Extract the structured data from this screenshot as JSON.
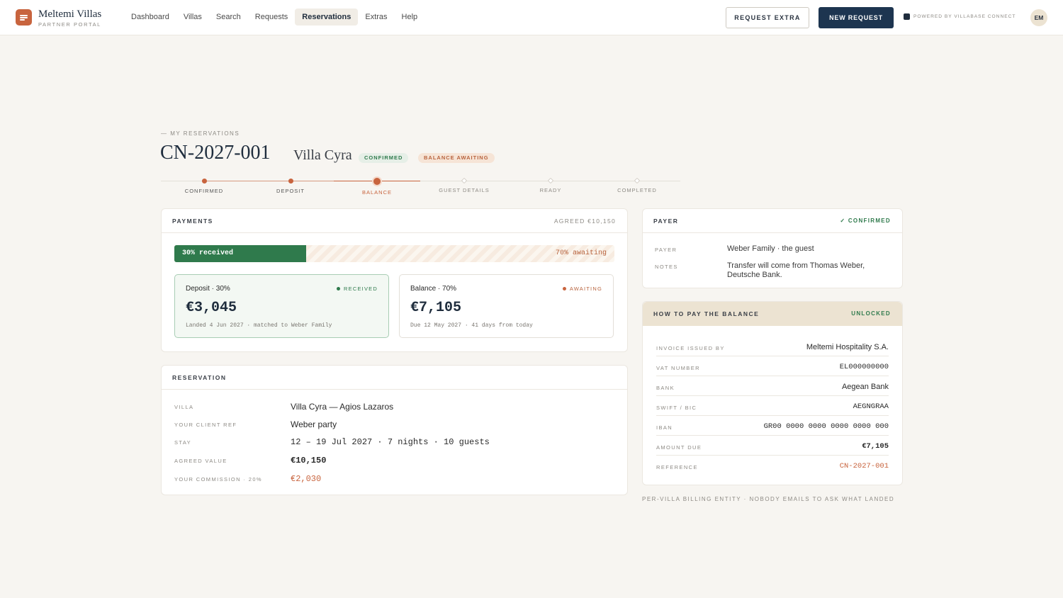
{
  "brand": {
    "name": "Meltemi Villas",
    "subtitle": "PARTNER PORTAL",
    "icon": "menu-lines-icon"
  },
  "nav": {
    "items": [
      "Dashboard",
      "Villas",
      "Search",
      "Requests",
      "Reservations",
      "Extras",
      "Help"
    ],
    "active": "Reservations"
  },
  "header": {
    "request_extra": "REQUEST EXTRA",
    "new_request": "NEW REQUEST",
    "powered_by": "POWERED BY VILLABASE CONNECT",
    "avatar": "EM"
  },
  "page": {
    "breadcrumb": "— MY RESERVATIONS",
    "reservation_id": "CN-2027-001",
    "villa": "Villa Cyra",
    "badges": [
      "CONFIRMED",
      "BALANCE AWAITING"
    ]
  },
  "stepper": {
    "steps": [
      "CONFIRMED",
      "DEPOSIT",
      "BALANCE",
      "GUEST DETAILS",
      "READY",
      "COMPLETED"
    ],
    "current_index": 2
  },
  "payments": {
    "title": "PAYMENTS",
    "agreed": "AGREED €10,150",
    "received_percent": 30,
    "received_label": "30% received",
    "awaiting_label": "70% awaiting",
    "deposit": {
      "label": "Deposit · 30%",
      "status": "RECEIVED",
      "amount": "€3,045",
      "note": "Landed 4 Jun 2027 · matched to Weber Family"
    },
    "balance": {
      "label": "Balance · 70%",
      "status": "AWAITING",
      "amount": "€7,105",
      "note": "Due 12 May 2027 · 41 days from today"
    }
  },
  "reservation": {
    "title": "RESERVATION",
    "rows": [
      {
        "label": "VILLA",
        "value": "Villa Cyra — Agios Lazaros"
      },
      {
        "label": "YOUR CLIENT REF",
        "value": "Weber party"
      },
      {
        "label": "STAY",
        "value": "12 – 19 Jul 2027 · 7 nights · 10 guests"
      },
      {
        "label": "AGREED VALUE",
        "value": "€10,150"
      },
      {
        "label": "YOUR COMMISSION · 20%",
        "value": "€2,030"
      }
    ]
  },
  "payer": {
    "title": "PAYER",
    "status": "✓ CONFIRMED",
    "rows": [
      {
        "label": "PAYER",
        "value": "Weber Family · the guest"
      },
      {
        "label": "NOTES",
        "value": "Transfer will come from Thomas Weber, Deutsche Bank."
      }
    ]
  },
  "how_to_pay": {
    "title": "HOW TO PAY THE BALANCE",
    "status": "UNLOCKED",
    "rows": [
      {
        "label": "INVOICE ISSUED BY",
        "value": "Meltemi Hospitality S.A."
      },
      {
        "label": "VAT NUMBER",
        "value": "EL000000000"
      },
      {
        "label": "BANK",
        "value": "Aegean Bank"
      },
      {
        "label": "SWIFT / BIC",
        "value": "AEGNGRAA"
      },
      {
        "label": "IBAN",
        "value": "GR00 0000 0000 0000 0000 000"
      },
      {
        "label": "AMOUNT DUE",
        "value": "€7,105"
      },
      {
        "label": "REFERENCE",
        "value": "CN-2027-001"
      }
    ]
  },
  "footnote": "PER-VILLA BILLING ENTITY · NOBODY EMAILS TO ASK WHAT LANDED",
  "colors": {
    "accent": "#c8643e",
    "navy": "#1d3550",
    "green": "#2f7a4c",
    "amber": "#b8643f"
  }
}
